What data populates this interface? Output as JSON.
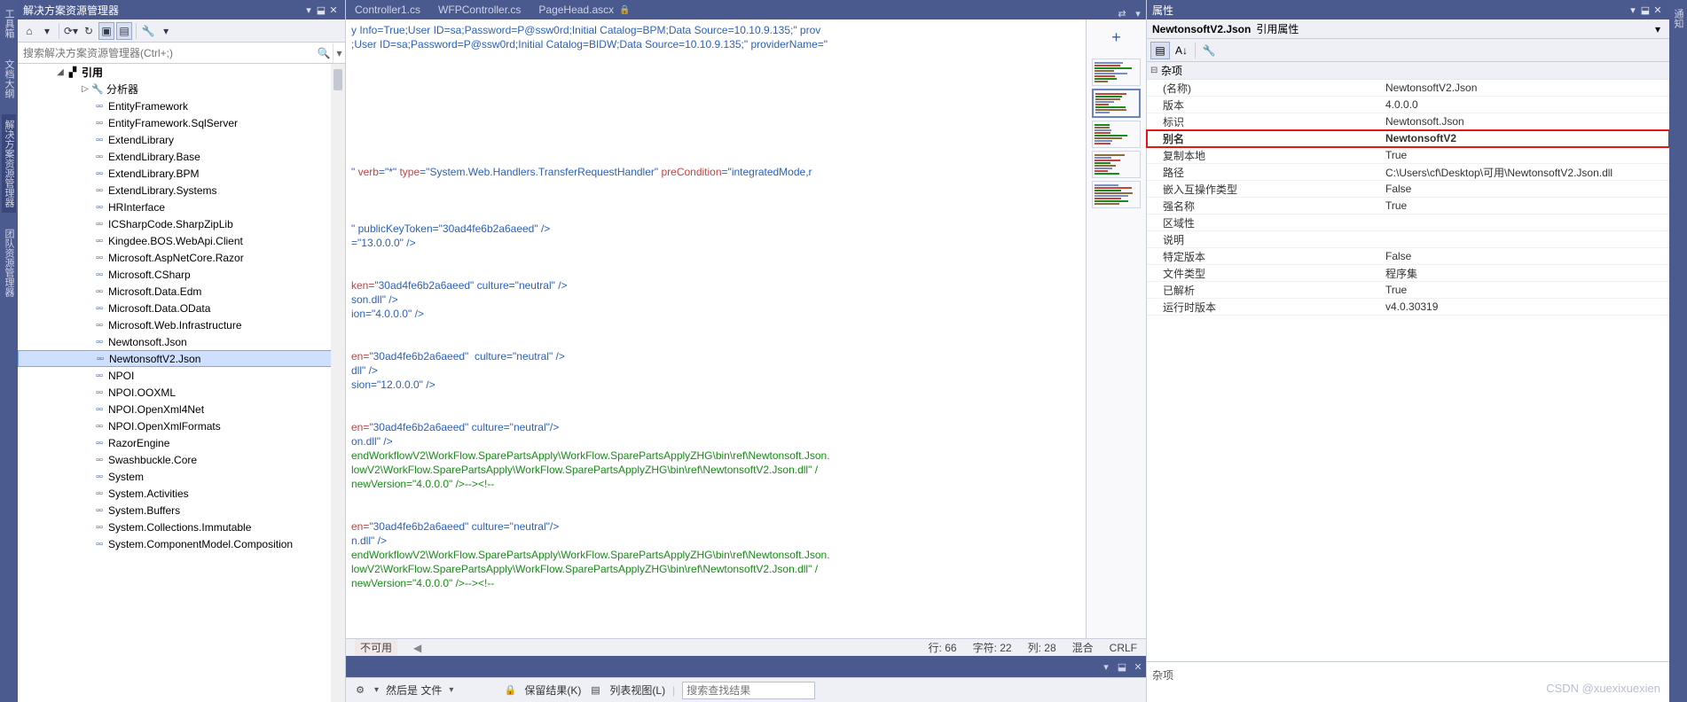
{
  "leftbar": [
    "工具箱",
    "文档大纲",
    "解决方案资源管理器",
    "团队资源管理器"
  ],
  "rightbar": [
    "通知"
  ],
  "solexp": {
    "title": "解决方案资源管理器",
    "search_ph": "搜索解决方案资源管理器(Ctrl+;)",
    "root": "引用",
    "analyzer": "分析器",
    "refs": [
      "EntityFramework",
      "EntityFramework.SqlServer",
      "ExtendLibrary",
      "ExtendLibrary.Base",
      "ExtendLibrary.BPM",
      "ExtendLibrary.Systems",
      "HRInterface",
      "ICSharpCode.SharpZipLib",
      "Kingdee.BOS.WebApi.Client",
      "Microsoft.AspNetCore.Razor",
      "Microsoft.CSharp",
      "Microsoft.Data.Edm",
      "Microsoft.Data.OData",
      "Microsoft.Web.Infrastructure",
      "Newtonsoft.Json",
      "NewtonsoftV2.Json",
      "NPOI",
      "NPOI.OOXML",
      "NPOI.OpenXml4Net",
      "NPOI.OpenXmlFormats",
      "RazorEngine",
      "Swashbuckle.Core",
      "System",
      "System.Activities",
      "System.Buffers",
      "System.Collections.Immutable",
      "System.ComponentModel.Composition"
    ]
  },
  "tabs": [
    {
      "label": "Controller1.cs"
    },
    {
      "label": "WFPController.cs"
    },
    {
      "label": "PageHead.ascx",
      "locked": true
    }
  ],
  "editor_lines": [
    {
      "t": "y Info=True;User ID=sa;Password=P@ssw0rd;Initial Catalog=BPM;Data Source=10.10.9.135;\" prov",
      "cls": "c-str"
    },
    {
      "t": ";User ID=sa;Password=P@ssw0rd;Initial Catalog=BIDW;Data Source=10.10.9.135;\" providerName=\"",
      "cls": "c-str"
    },
    {
      "t": ""
    },
    {
      "t": ""
    },
    {
      "t": ""
    },
    {
      "t": ""
    },
    {
      "t": ""
    },
    {
      "t": ""
    },
    {
      "t": ""
    },
    {
      "t": ""
    },
    {
      "t": "\" verb=\"*\" type=\"System.Web.Handlers.TransferRequestHandler\" preCondition=\"integratedMode,r",
      "cls": "mix1"
    },
    {
      "t": ""
    },
    {
      "t": ""
    },
    {
      "t": ""
    },
    {
      "t": "\" publicKeyToken=\"30ad4fe6b2a6aeed\" />",
      "cls": "mix2"
    },
    {
      "t": "=\"13.0.0.0\" />",
      "cls": "mix3"
    },
    {
      "t": ""
    },
    {
      "t": ""
    },
    {
      "t": "ken=\"30ad4fe6b2a6aeed\" culture=\"neutral\" />",
      "cls": "mix2"
    },
    {
      "t": "son.dll\" />",
      "cls": "mix3"
    },
    {
      "t": "ion=\"4.0.0.0\" />",
      "cls": "mix3"
    },
    {
      "t": ""
    },
    {
      "t": ""
    },
    {
      "t": "en=\"30ad4fe6b2a6aeed\"  culture=\"neutral\" />",
      "cls": "mix2"
    },
    {
      "t": "dll\" />",
      "cls": "mix3"
    },
    {
      "t": "sion=\"12.0.0.0\" />",
      "cls": "mix3"
    },
    {
      "t": ""
    },
    {
      "t": ""
    },
    {
      "t": "en=\"30ad4fe6b2a6aeed\" culture=\"neutral\"/>",
      "cls": "mix2"
    },
    {
      "t": "on.dll\" />",
      "cls": "mix3"
    },
    {
      "t": "endWorkflowV2\\WorkFlow.SparePartsApply\\WorkFlow.SparePartsApplyZHG\\bin\\ref\\Newtonsoft.Json.",
      "cls": "c-green"
    },
    {
      "t": "lowV2\\WorkFlow.SparePartsApply\\WorkFlow.SparePartsApplyZHG\\bin\\ref\\NewtonsoftV2.Json.dll\" /",
      "cls": "c-green"
    },
    {
      "t": "newVersion=\"4.0.0.0\" />--><!--",
      "cls": "c-green"
    },
    {
      "t": ""
    },
    {
      "t": ""
    },
    {
      "t": "en=\"30ad4fe6b2a6aeed\" culture=\"neutral\"/>",
      "cls": "mix2"
    },
    {
      "t": "n.dll\" />",
      "cls": "mix3"
    },
    {
      "t": "endWorkflowV2\\WorkFlow.SparePartsApply\\WorkFlow.SparePartsApplyZHG\\bin\\ref\\Newtonsoft.Json.",
      "cls": "c-green"
    },
    {
      "t": "lowV2\\WorkFlow.SparePartsApply\\WorkFlow.SparePartsApplyZHG\\bin\\ref\\NewtonsoftV2.Json.dll\" /",
      "cls": "c-green"
    },
    {
      "t": "newVersion=\"4.0.0.0\" />--><!--",
      "cls": "c-green"
    }
  ],
  "status": {
    "na": "不可用",
    "row": "行: 66",
    "char": "字符: 22",
    "col": "列: 28",
    "mix": "混合",
    "crlf": "CRLF"
  },
  "find": {
    "then": "然后是 文件",
    "keep": "保留结果(K)",
    "list": "列表视图(L)",
    "ph": "搜索查找结果"
  },
  "props": {
    "title": "属性",
    "name": "NewtonsoftV2.Json",
    "subtitle": "引用属性",
    "cat": "杂项",
    "rows": [
      {
        "k": "(名称)",
        "v": "NewtonsoftV2.Json"
      },
      {
        "k": "版本",
        "v": "4.0.0.0"
      },
      {
        "k": "标识",
        "v": "Newtonsoft.Json"
      },
      {
        "k": "别名",
        "v": "NewtonsoftV2",
        "hl": true
      },
      {
        "k": "复制本地",
        "v": "True"
      },
      {
        "k": "路径",
        "v": "C:\\Users\\cf\\Desktop\\可用\\NewtonsoftV2.Json.dll"
      },
      {
        "k": "嵌入互操作类型",
        "v": "False"
      },
      {
        "k": "强名称",
        "v": "True"
      },
      {
        "k": "区域性",
        "v": ""
      },
      {
        "k": "说明",
        "v": ""
      },
      {
        "k": "特定版本",
        "v": "False"
      },
      {
        "k": "文件类型",
        "v": "程序集"
      },
      {
        "k": "已解析",
        "v": "True"
      },
      {
        "k": "运行时版本",
        "v": "v4.0.30319"
      }
    ],
    "help": "杂项"
  },
  "watermark": "CSDN @xuexixuexien"
}
